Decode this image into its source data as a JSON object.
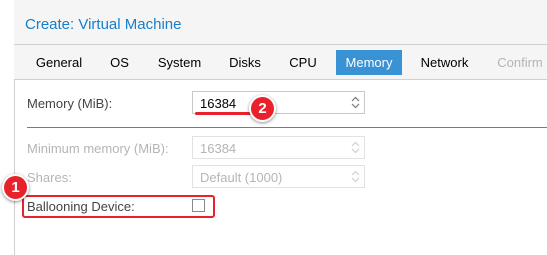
{
  "window": {
    "title": "Create: Virtual Machine"
  },
  "tabs": [
    {
      "label": "General",
      "state": "normal"
    },
    {
      "label": "OS",
      "state": "normal"
    },
    {
      "label": "System",
      "state": "normal"
    },
    {
      "label": "Disks",
      "state": "normal"
    },
    {
      "label": "CPU",
      "state": "normal"
    },
    {
      "label": "Memory",
      "state": "active"
    },
    {
      "label": "Network",
      "state": "normal"
    },
    {
      "label": "Confirm",
      "state": "disabled"
    }
  ],
  "form": {
    "memory": {
      "label": "Memory (MiB):",
      "value": "16384"
    },
    "min_memory": {
      "label": "Minimum memory (MiB):",
      "value": "16384"
    },
    "shares": {
      "label": "Shares:",
      "value": "Default (1000)"
    },
    "ballooning": {
      "label": "Ballooning Device:",
      "checked": false
    }
  },
  "annotations": {
    "badge_1": "1",
    "badge_2": "2",
    "color": "#e8212a"
  },
  "colors": {
    "title": "#157fcc",
    "active_tab": "#3892d4"
  }
}
